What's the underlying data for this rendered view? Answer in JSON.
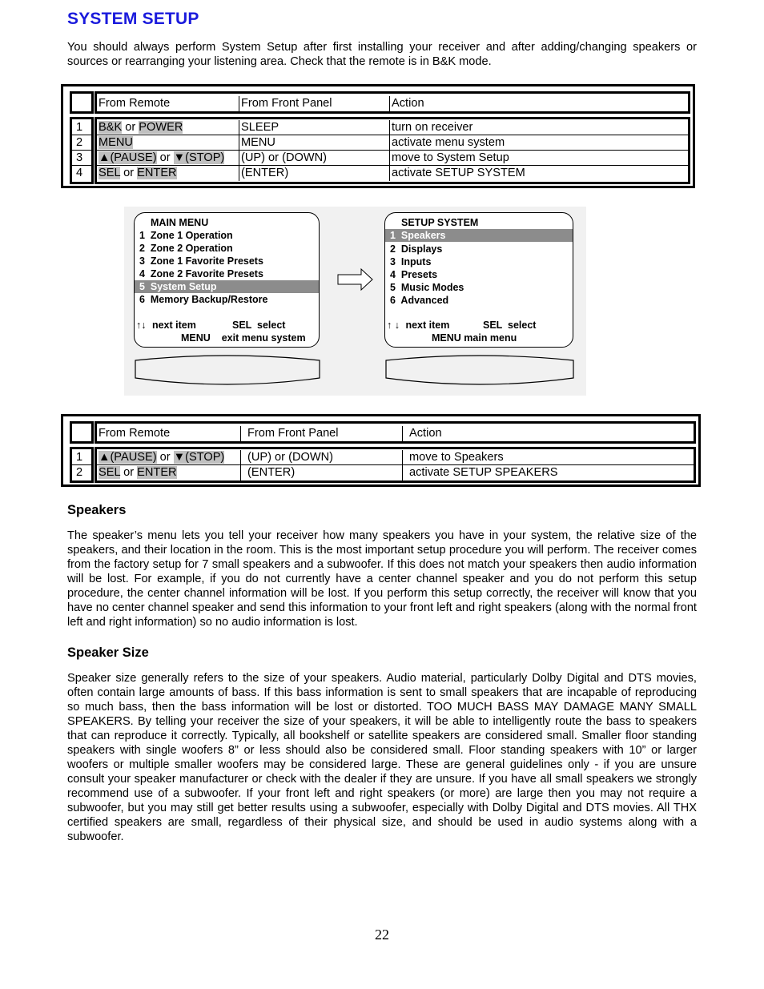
{
  "page": {
    "title": "SYSTEM SETUP",
    "intro": "You should always perform System Setup after first installing your receiver and after adding/changing speakers or sources or rearranging your listening area. Check that the remote is in B&K mode.",
    "page_number": "22"
  },
  "table1": {
    "headers": [
      "From Remote",
      "From Front Panel",
      "Action"
    ],
    "rows": [
      {
        "num": "1",
        "remote": [
          {
            "t": "B&K",
            "hl": true
          },
          {
            "t": " or ",
            "hl": false
          },
          {
            "t": "POWER",
            "hl": true
          }
        ],
        "panel": "SLEEP",
        "action": "turn on receiver"
      },
      {
        "num": "2",
        "remote": [
          {
            "t": "MENU",
            "hl": true
          }
        ],
        "panel": "MENU",
        "action": "activate menu system"
      },
      {
        "num": "3",
        "remote": [
          {
            "t": "▲(PAUSE)",
            "hl": true
          },
          {
            "t": " or ",
            "hl": false
          },
          {
            "t": "▼(STOP)",
            "hl": true
          }
        ],
        "panel": "(UP) or (DOWN)",
        "action": "move to System Setup"
      },
      {
        "num": "4",
        "remote": [
          {
            "t": "SEL",
            "hl": true
          },
          {
            "t": " or ",
            "hl": false
          },
          {
            "t": "ENTER",
            "hl": true
          }
        ],
        "panel": "(ENTER)",
        "action": "activate SETUP SYSTEM"
      }
    ]
  },
  "diagram": {
    "main_menu": {
      "title": "MAIN MENU",
      "items": [
        "1  Zone 1 Operation",
        "2  Zone 2 Operation",
        "3  Zone 1 Favorite Presets",
        "4  Zone 2 Favorite Presets",
        "5  System Setup",
        "6  Memory Backup/Restore"
      ],
      "selected_index": 4,
      "footer1_arrows": "↑↓",
      "footer1_next": "next item",
      "footer1_sel": "SEL  select",
      "footer2": "MENU    exit menu system"
    },
    "setup_menu": {
      "title": "SETUP SYSTEM",
      "items": [
        "1  Speakers",
        "2  Displays",
        "3  Inputs",
        "4  Presets",
        "5  Music Modes",
        "6  Advanced"
      ],
      "selected_index": 0,
      "footer1_arrows": "↑ ↓",
      "footer1_next": "next item",
      "footer1_sel": "SEL  select",
      "footer2": "MENU main menu"
    }
  },
  "table2": {
    "headers": [
      "From Remote",
      "From Front Panel",
      "Action"
    ],
    "rows": [
      {
        "num": "1",
        "remote": [
          {
            "t": "▲(PAUSE)",
            "hl": true
          },
          {
            "t": " or ",
            "hl": false
          },
          {
            "t": "▼(STOP)",
            "hl": true
          }
        ],
        "panel": "(UP) or (DOWN)",
        "action": "move to Speakers"
      },
      {
        "num": "2",
        "remote": [
          {
            "t": "SEL",
            "hl": true
          },
          {
            "t": " or ",
            "hl": false
          },
          {
            "t": "ENTER",
            "hl": true
          }
        ],
        "panel": "(ENTER)",
        "action": "activate SETUP SPEAKERS"
      }
    ]
  },
  "speakers": {
    "heading": "Speakers",
    "body": "The speaker’s menu lets you tell your receiver how many speakers you have in your system, the relative size of the speakers, and their location in the room. This is the most important setup procedure you will perform. The receiver comes from the factory setup for 7 small speakers and a subwoofer. If this does not match your speakers then audio information will be lost. For example, if you do not currently have a center channel speaker and you do not perform this setup procedure, the center channel information will be lost. If you perform this setup correctly, the receiver will know that you have no center channel speaker and send this information to your front left and right speakers (along with the normal front left and right information) so no audio information is lost."
  },
  "speaker_size": {
    "heading": "Speaker Size",
    "body": "Speaker size generally refers to the size of your speakers. Audio material, particularly Dolby Digital and DTS movies, often contain large amounts of bass. If this bass information is sent to small speakers that are incapable of reproducing so much bass, then the bass information will be lost or distorted. TOO MUCH BASS MAY DAMAGE MANY SMALL SPEAKERS. By telling your receiver the size of your speakers, it will be able to intelligently route the bass to speakers that can reproduce it correctly. Typically, all bookshelf or satellite speakers are considered small. Smaller floor standing speakers with single woofers 8” or less should also be considered small. Floor standing speakers with 10” or larger woofers or multiple smaller woofers may be considered large. These are general guidelines only - if you are unsure consult your speaker manufacturer or check with the dealer if they are unsure. If you have all small speakers we strongly recommend use of a subwoofer. If your front left and right speakers (or more) are large then you may not require a subwoofer, but you may still get better results using a subwoofer, especially with Dolby Digital and DTS movies. All THX certified speakers are small, regardless of their physical size, and should be used in audio systems along with a subwoofer."
  }
}
